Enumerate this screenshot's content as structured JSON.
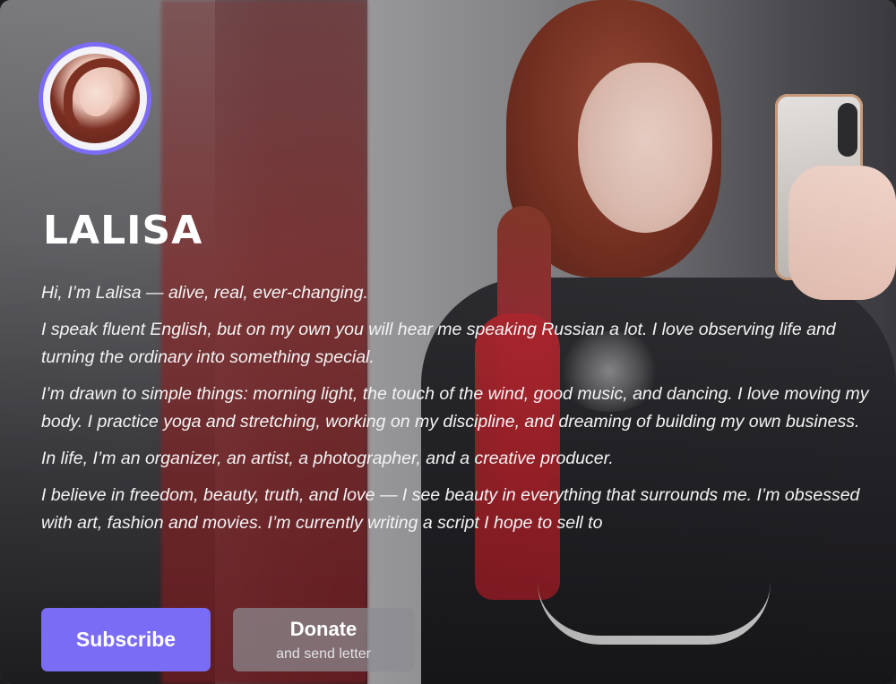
{
  "profile": {
    "name": "LALISA"
  },
  "bio": {
    "paragraphs": [
      "Hi, I’m Lalisa — alive, real, ever-changing.",
      "I speak fluent English, but on my own you will hear me speaking Russian a lot. I love observing life and turning the ordinary into something special.",
      "I’m drawn to simple things: morning light, the touch of the wind, good music, and dancing. I love moving my body. I practice yoga and stretching, working on my discipline, and dreaming of building my own business.",
      "In life, I’m an organizer, an artist, a photographer, and a creative producer.",
      "I believe in freedom, beauty, truth, and love — I see beauty in everything that surrounds me. I’m obsessed with art, fashion and movies. I’m currently writing a script I hope to sell to"
    ]
  },
  "actions": {
    "subscribe_label": "Subscribe",
    "donate_label": "Donate",
    "donate_sublabel": "and send letter"
  },
  "colors": {
    "accent": "#7a6cf4",
    "donate_bg": "#8c8c91"
  },
  "icons": {
    "avatar": "profile-photo"
  }
}
